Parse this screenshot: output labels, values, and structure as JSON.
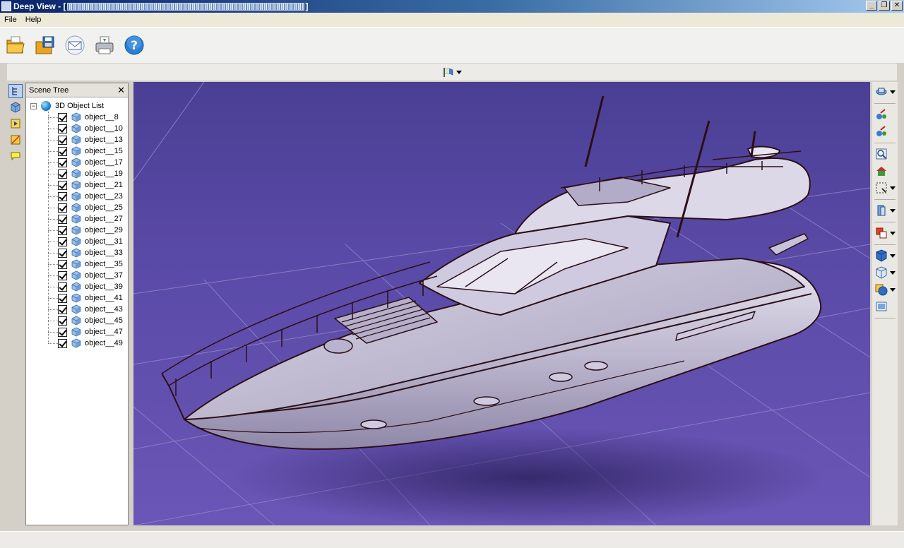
{
  "window": {
    "title": "Deep View - [",
    "title_suffix": "]"
  },
  "menu": {
    "items": [
      "File",
      "Help"
    ]
  },
  "toolbar": {
    "buttons": [
      "open-folder-icon",
      "save-icon",
      "email-icon",
      "print-icon",
      "help-icon"
    ]
  },
  "subtoolbar": {
    "icon": "flag-view-icon"
  },
  "left_strip": {
    "buttons": [
      "scene-tree-icon",
      "cube-icon",
      "animation-icon",
      "measure-icon",
      "comment-icon"
    ]
  },
  "scene_tree": {
    "title": "Scene Tree",
    "close": "✕",
    "root_label": "3D Object List",
    "objects": [
      "object__8",
      "object__10",
      "object__13",
      "object__15",
      "object__17",
      "object__19",
      "object__21",
      "object__23",
      "object__25",
      "object__27",
      "object__29",
      "object__31",
      "object__33",
      "object__35",
      "object__37",
      "object__39",
      "object__41",
      "object__43",
      "object__45",
      "object__47",
      "object__49"
    ]
  },
  "right_bar": {
    "buttons": [
      "rotate-icon",
      "pan-icon",
      "zoom-icon",
      "fit-icon",
      "home-icon",
      "zoom-window-icon",
      "section-icon",
      "display-mode-icon",
      "shaded-icon",
      "wireframe-icon",
      "materials-icon",
      "background-icon"
    ]
  },
  "colors": {
    "viewport_bg": "#5a4aa7",
    "grid": "#8f84c9",
    "boat_body": "#c9c4d8",
    "outline": "#2b0f18"
  }
}
